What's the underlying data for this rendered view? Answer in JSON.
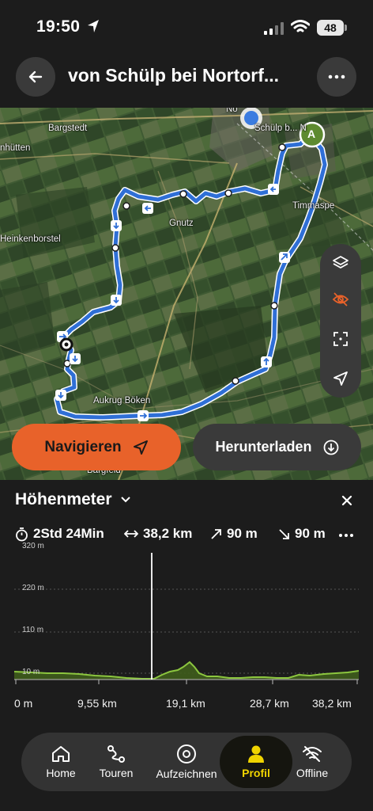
{
  "status_bar": {
    "time": "19:50",
    "battery": "48"
  },
  "header": {
    "title": "von Schülp bei Nortorf..."
  },
  "map": {
    "places": [
      {
        "name": "Bargstedt"
      },
      {
        "name": "nhütten"
      },
      {
        "name": "Schülp b... N"
      },
      {
        "name": "Timmaspe"
      },
      {
        "name": "Gnutz"
      },
      {
        "name": "Heinkenborstel"
      },
      {
        "name": "Aukrug Böken"
      },
      {
        "name": "Bargfeld"
      },
      {
        "name": "No"
      }
    ],
    "start_marker": "A"
  },
  "actions": {
    "navigate_label": "Navigieren",
    "download_label": "Herunterladen"
  },
  "elevation": {
    "title": "Höhenmeter",
    "duration": "2Std 24Min",
    "distance": "38,2 km",
    "ascent": "90 m",
    "descent": "90 m",
    "y_labels": [
      "320 m",
      "220 m",
      "110 m",
      "10 m"
    ],
    "x_labels": [
      "0 m",
      "9,55 km",
      "19,1 km",
      "28,7 km",
      "38,2 km"
    ]
  },
  "tabbar": {
    "tabs": [
      {
        "label": "Home"
      },
      {
        "label": "Touren"
      },
      {
        "label": "Aufzeichnen"
      },
      {
        "label": "Profil"
      },
      {
        "label": "Offline"
      }
    ],
    "active": "Profil"
  },
  "colors": {
    "accent": "#e8622a",
    "route": "#2f6fd6",
    "elevation": "#8cc63f"
  }
}
